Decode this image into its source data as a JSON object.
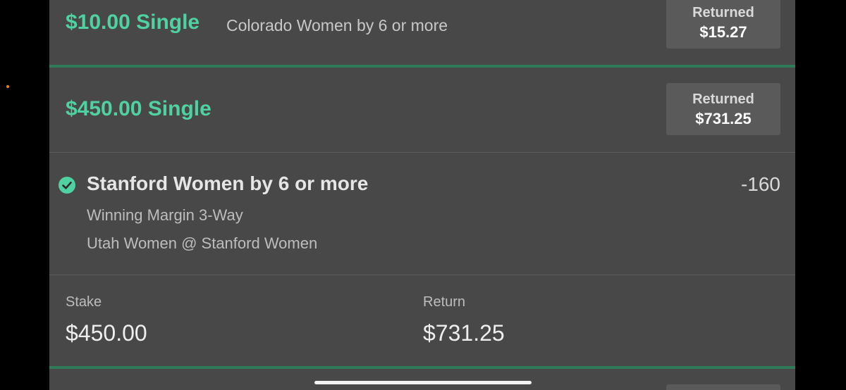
{
  "bets": [
    {
      "title": "$10.00 Single",
      "description": "Colorado Women by 6 or more",
      "returned_label": "Returned",
      "returned_amount": "$15.27"
    },
    {
      "title": "$450.00 Single",
      "returned_label": "Returned",
      "returned_amount": "$731.25",
      "selection": {
        "name": "Stanford Women by 6 or more",
        "odds": "-160",
        "market": "Winning Margin 3-Way",
        "event": "Utah Women @ Stanford Women",
        "status_icon": "check-circle-icon"
      },
      "stake_label": "Stake",
      "stake_value": "$450.00",
      "return_label": "Return",
      "return_value": "$731.25"
    }
  ],
  "colors": {
    "accent": "#4fd1a1",
    "panel": "#484848",
    "divider_green": "#2f7a58",
    "notification_dot": "#e8822a"
  }
}
